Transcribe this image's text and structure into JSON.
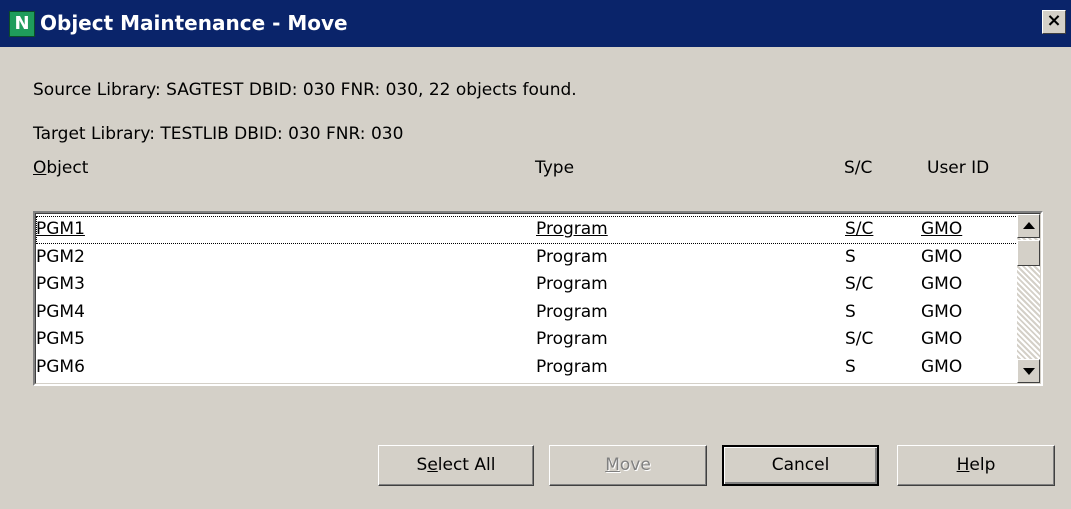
{
  "window": {
    "title": "Object Maintenance - Move",
    "app_icon_letter": "N",
    "close_glyph": "×"
  },
  "info": {
    "source": "Source Library: SAGTEST  DBID: 030  FNR: 030, 22 objects found.",
    "target": "Target Library: TESTLIB  DBID: 030  FNR: 030"
  },
  "columns": {
    "object_mnemonic": "O",
    "object_rest": "bject",
    "type": "Type",
    "sc": "S/C",
    "user": "User ID"
  },
  "rows": [
    {
      "name": "PGM1",
      "type": "Program",
      "sc": "S/C",
      "user": "GMO"
    },
    {
      "name": "PGM2",
      "type": "Program",
      "sc": "S",
      "user": "GMO"
    },
    {
      "name": "PGM3",
      "type": "Program",
      "sc": "S/C",
      "user": "GMO"
    },
    {
      "name": "PGM4",
      "type": "Program",
      "sc": "S",
      "user": "GMO"
    },
    {
      "name": "PGM5",
      "type": "Program",
      "sc": "S/C",
      "user": "GMO"
    },
    {
      "name": "PGM6",
      "type": "Program",
      "sc": "S",
      "user": "GMO"
    }
  ],
  "buttons": {
    "select_all": {
      "pre": "S",
      "key": "e",
      "post": "lect All"
    },
    "move": {
      "pre": "",
      "key": "M",
      "post": "ove"
    },
    "cancel": {
      "label": "Cancel"
    },
    "help": {
      "pre": "",
      "key": "H",
      "post": "elp"
    }
  },
  "colors": {
    "title_bar": "#0a246a",
    "dialog_bg": "#d4d0c8",
    "disabled_text": "#808080"
  },
  "icons": {
    "app": "natural-app-icon",
    "close": "close-icon",
    "scroll_up": "arrow-up-icon",
    "scroll_down": "arrow-down-icon"
  }
}
